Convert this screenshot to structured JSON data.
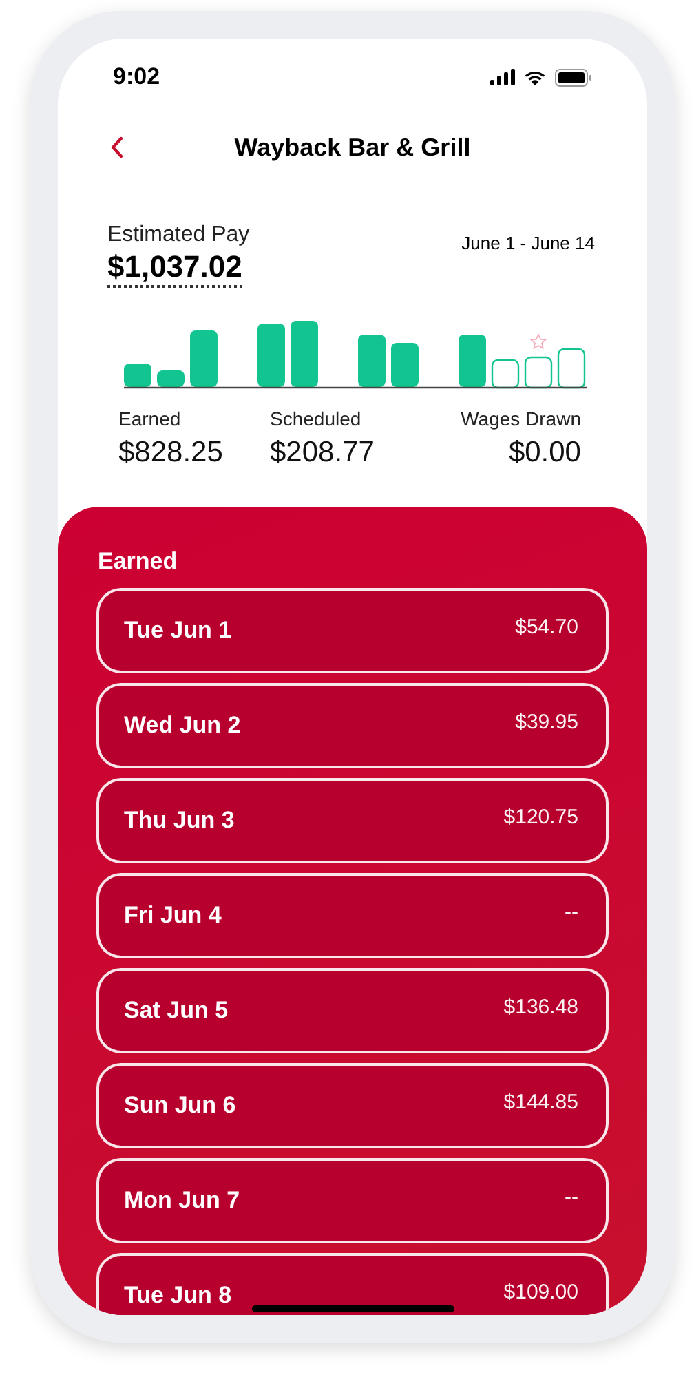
{
  "status_bar": {
    "time": "9:02"
  },
  "header": {
    "title": "Wayback Bar & Grill"
  },
  "summary": {
    "label": "Estimated Pay",
    "amount": "$1,037.02",
    "date_range": "June 1 - June 14"
  },
  "totals": [
    {
      "label": "Earned",
      "value": "$828.25"
    },
    {
      "label": "Scheduled",
      "value": "$208.77"
    },
    {
      "label": "Wages Drawn",
      "value": "$0.00"
    }
  ],
  "earned": {
    "title": "Earned",
    "days": [
      {
        "day": "Tue Jun 1",
        "amount": "$54.70"
      },
      {
        "day": "Wed Jun 2",
        "amount": "$39.95"
      },
      {
        "day": "Thu Jun 3",
        "amount": "$120.75"
      },
      {
        "day": "Fri Jun 4",
        "amount": "--"
      },
      {
        "day": "Sat Jun 5",
        "amount": "$136.48"
      },
      {
        "day": "Sun Jun 6",
        "amount": "$144.85"
      },
      {
        "day": "Mon Jun 7",
        "amount": "--"
      },
      {
        "day": "Tue Jun 8",
        "amount": "$109.00"
      }
    ]
  }
}
